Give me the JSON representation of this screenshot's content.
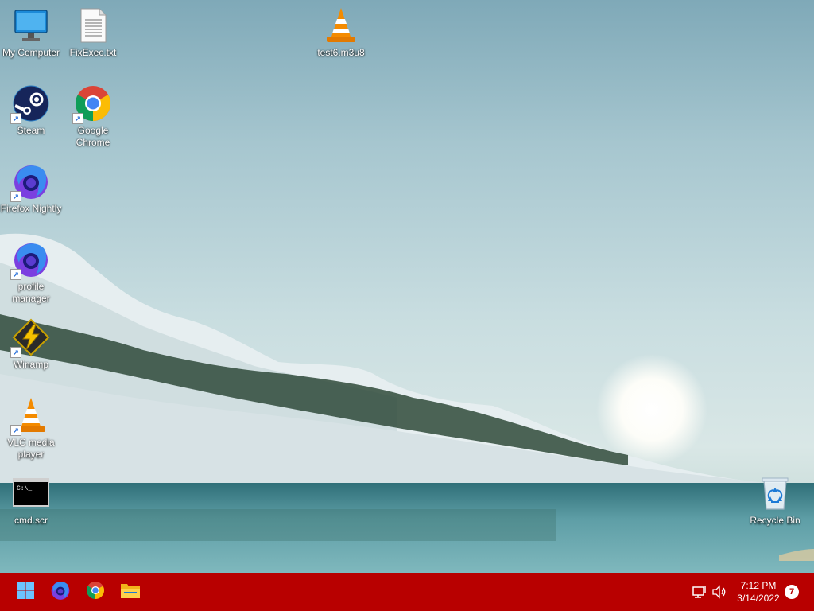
{
  "desktop": {
    "icons": [
      {
        "label": "My Computer",
        "icon": "monitor-icon"
      },
      {
        "label": "FixExec.txt",
        "icon": "text-file-icon"
      },
      {
        "label": "test6.m3u8",
        "icon": "vlc-cone-icon"
      },
      {
        "label": "Steam",
        "icon": "steam-icon",
        "shortcut": true
      },
      {
        "label": "Google Chrome",
        "icon": "chrome-icon",
        "shortcut": true
      },
      {
        "label": "Firefox Nightly",
        "icon": "firefox-nightly-icon",
        "shortcut": true
      },
      {
        "label": "profile manager",
        "icon": "firefox-nightly-icon",
        "shortcut": true
      },
      {
        "label": "Winamp",
        "icon": "winamp-icon",
        "shortcut": true
      },
      {
        "label": "VLC media player",
        "icon": "vlc-cone-icon",
        "shortcut": true
      },
      {
        "label": "cmd.scr",
        "icon": "cmd-icon"
      },
      {
        "label": "Recycle Bin",
        "icon": "recycle-bin-icon"
      }
    ]
  },
  "taskbar": {
    "color": "#b80000",
    "pinned": [
      {
        "name": "Start",
        "icon": "windows-start-icon"
      },
      {
        "name": "Firefox",
        "icon": "firefox-icon"
      },
      {
        "name": "Google Chrome",
        "icon": "chrome-icon"
      },
      {
        "name": "File Explorer",
        "icon": "folder-icon"
      }
    ],
    "tray": {
      "network_icon": "network-icon",
      "volume_icon": "speaker-icon",
      "time": "7:12 PM",
      "date": "3/14/2022",
      "notifications": "7"
    }
  }
}
